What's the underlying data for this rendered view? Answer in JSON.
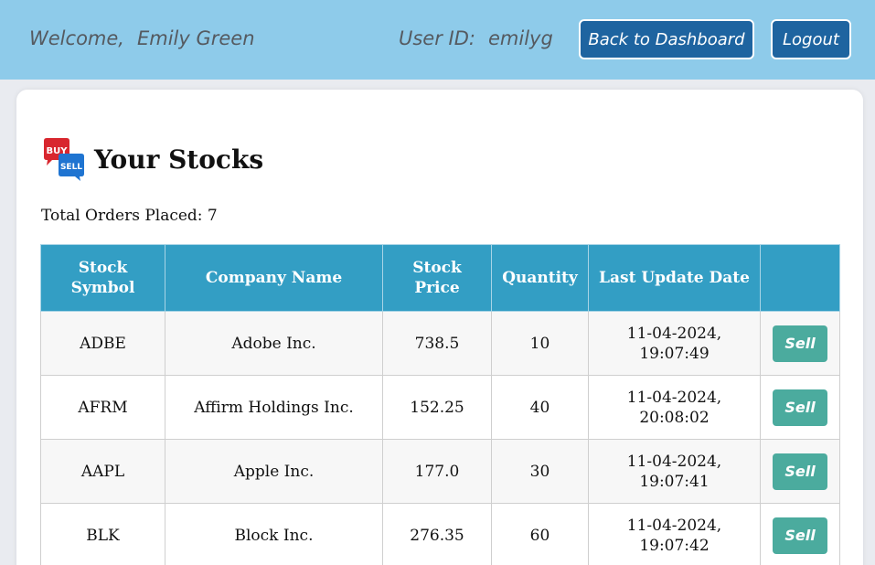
{
  "header": {
    "welcome_label": "Welcome,",
    "user_name": "Emily Green",
    "user_id_label": "User ID:",
    "user_id": "emilyg",
    "dashboard_button": "Back to Dashboard",
    "logout_button": "Logout"
  },
  "page": {
    "title": "Your Stocks",
    "icon_buy": "BUY",
    "icon_sell": "SELL",
    "orders_text": "Total Orders Placed: 7"
  },
  "table": {
    "headers": [
      "Stock\nSymbol",
      "Company Name",
      "Stock\nPrice",
      "Quantity",
      "Last Update Date",
      ""
    ],
    "action_label": "Sell",
    "rows": [
      {
        "symbol": "ADBE",
        "company": "Adobe Inc.",
        "price": "738.5",
        "quantity": "10",
        "date": "11-04-2024,",
        "time": "19:07:49"
      },
      {
        "symbol": "AFRM",
        "company": "Affirm Holdings Inc.",
        "price": "152.25",
        "quantity": "40",
        "date": "11-04-2024,",
        "time": "20:08:02"
      },
      {
        "symbol": "AAPL",
        "company": "Apple Inc.",
        "price": "177.0",
        "quantity": "30",
        "date": "11-04-2024,",
        "time": "19:07:41"
      },
      {
        "symbol": "BLK",
        "company": "Block Inc.",
        "price": "276.35",
        "quantity": "60",
        "date": "11-04-2024,",
        "time": "19:07:42"
      }
    ]
  },
  "colors": {
    "header_bg": "#8ecbea",
    "nav_button": "#1e64a0",
    "table_header": "#339ec4",
    "sell_button": "#4bab9e"
  }
}
